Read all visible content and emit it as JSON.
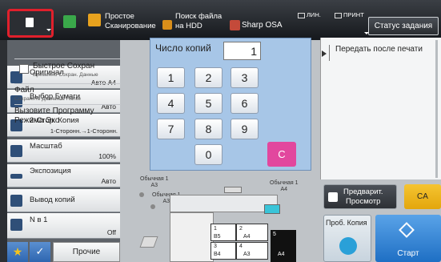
{
  "header": {
    "simple_scan": "Простое\nСканирование",
    "file_search": "Поиск файла\nна HDD",
    "sharp_osa": "Sharp OSA",
    "ind_line": "ЛИН.",
    "ind_print": "ПРИНТ",
    "job_status": "Статус задания"
  },
  "left_menu": [
    {
      "label": "Оригинал",
      "value": "Авто A4"
    },
    {
      "label": "Выбор Бумаги",
      "value": "Авто"
    },
    {
      "label": "2-Стор. Копия",
      "value": "1-Сторонн.→1-Сторонн."
    },
    {
      "label": "Масштаб",
      "value": "100%"
    },
    {
      "label": "Экспозиция",
      "value": "Авто"
    },
    {
      "label": "Вывод копий",
      "value": ""
    },
    {
      "label": "N в 1",
      "value": "Off"
    }
  ],
  "footer_left": {
    "other_label": "Прочие"
  },
  "keypad": {
    "title": "Число копий",
    "value": "1",
    "keys": [
      "1",
      "2",
      "3",
      "4",
      "5",
      "6",
      "7",
      "8",
      "9",
      "0"
    ],
    "clear": "C"
  },
  "right_panel": {
    "transfer": "Передать после печати",
    "quick_save": "Быстрое Сохран",
    "quick_save_sub": "Временно Сохран. Данные",
    "file": "Файл",
    "file_sub": "Сохранить Данные в Папке",
    "eco": "Вызовите Программу Режима Эко"
  },
  "diagram": {
    "tray_top": "Обычная 1\nA3",
    "tray_mid": "Обычная 1\nA3",
    "tray_right": "Обычная 1\nA4",
    "cassettes": [
      [
        "1",
        "B5"
      ],
      [
        "2",
        "A4"
      ],
      [
        "3",
        "B4"
      ],
      [
        "4",
        "A3"
      ]
    ],
    "side_tray": [
      "5",
      "A4"
    ]
  },
  "buttons": {
    "preview": "Предварит.\nПросмотр",
    "ca": "CA",
    "test_copy": "Проб. Копия",
    "start": "Старт"
  },
  "colors": {
    "highlight": "#e0202c",
    "clear_key": "#e2479e",
    "start": "#1e6fc4",
    "ca": "#f0b81d"
  }
}
